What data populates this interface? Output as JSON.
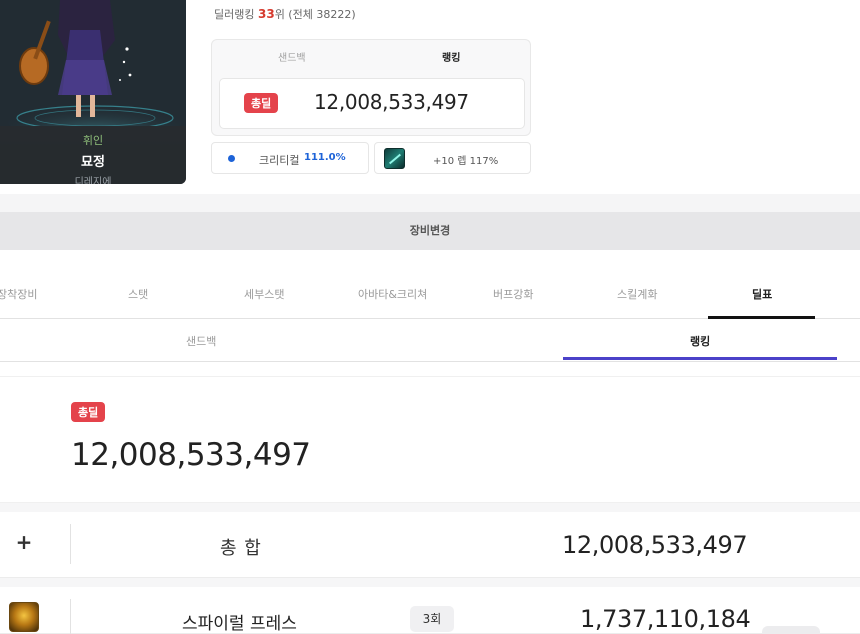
{
  "character": {
    "job": "휘인",
    "name": "묘정",
    "server": "디레지에"
  },
  "dealer_rank": {
    "prefix": "딜러랭킹",
    "rank": "33",
    "suffix": "위 (전체 38222)"
  },
  "rank_box": {
    "tab_sandbag": "샌드백",
    "tab_ranking": "랭킹",
    "badge": "총딜",
    "total": "12,008,533,497"
  },
  "stats": {
    "crit_label": "크리티컬",
    "crit_value": "111.0%",
    "weapon_label": "+10 렙 117%",
    "crit_dot_color": "#1d63d8"
  },
  "equip_change": "장비변경",
  "main_tabs": [
    "장착장비",
    "스탯",
    "세부스탯",
    "아바타&크리쳐",
    "버프강화",
    "스킬계화",
    "딜표"
  ],
  "sub_tabs": {
    "sandbag": "샌드백",
    "ranking": "랭킹"
  },
  "summary": {
    "badge": "총딜",
    "value": "12,008,533,497"
  },
  "rows": {
    "total": {
      "expand_icon": "+",
      "name": "총 합",
      "value": "12,008,533,497"
    },
    "skill": {
      "icon": "spiral-press-skill-icon",
      "name": "스파이럴 프레스",
      "hits": "3회",
      "value": "1,737,110,184"
    }
  },
  "colors": {
    "badge_red": "#e4434b",
    "accent_purple": "#4b41c9",
    "rank_red": "#d63b2f"
  }
}
